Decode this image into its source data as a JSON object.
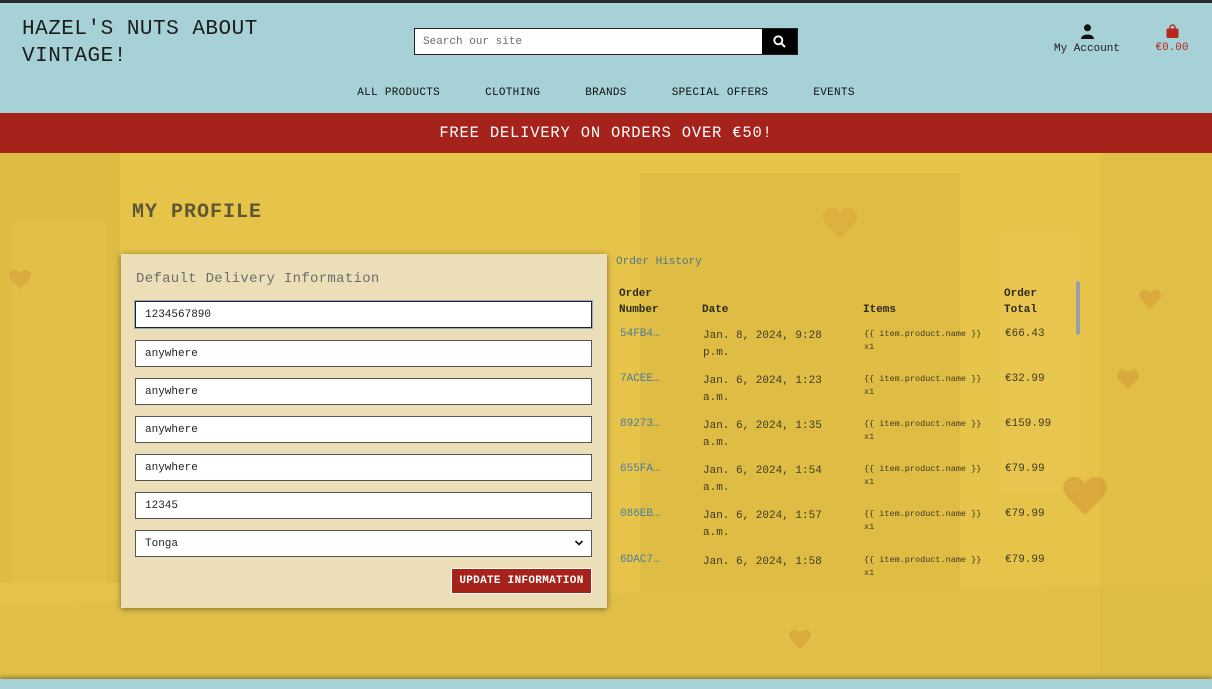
{
  "header": {
    "logo_line1": "HAZEL'S NUTS ABOUT",
    "logo_line2": "VINTAGE!",
    "search_placeholder": "Search our site",
    "account_label": "My Account",
    "bag_total": "€0.00"
  },
  "nav": [
    "ALL PRODUCTS",
    "CLOTHING",
    "BRANDS",
    "SPECIAL OFFERS",
    "EVENTS"
  ],
  "banner": "FREE DELIVERY ON ORDERS OVER €50!",
  "profile": {
    "title": "MY PROFILE",
    "form_title": "Default Delivery Information",
    "fields": [
      "1234567890",
      "anywhere",
      "anywhere",
      "anywhere",
      "anywhere",
      "12345"
    ],
    "country": "Tonga",
    "update_label": "UPDATE INFORMATION"
  },
  "orders": {
    "title": "Order History",
    "headers": {
      "number_1": "Order",
      "number_2": "Number",
      "date": "Date",
      "items": "Items",
      "total_1": "Order",
      "total_2": "Total"
    },
    "rows": [
      {
        "number": "54FB4…",
        "date_1": "Jan. 8, 2024, 9:28",
        "date_2": "p.m.",
        "item_1": "{{ item.product.name }}",
        "item_2": "x1",
        "total": "€66.43"
      },
      {
        "number": "7ACEE…",
        "date_1": "Jan. 6, 2024, 1:23",
        "date_2": "a.m.",
        "item_1": "{{ item.product.name }}",
        "item_2": "x1",
        "total": "€32.99"
      },
      {
        "number": "89273…",
        "date_1": "Jan. 6, 2024, 1:35",
        "date_2": "a.m.",
        "item_1": "{{ item.product.name }}",
        "item_2": "x1",
        "total": "€159.99"
      },
      {
        "number": "655FA…",
        "date_1": "Jan. 6, 2024, 1:54",
        "date_2": "a.m.",
        "item_1": "{{ item.product.name }}",
        "item_2": "x1",
        "total": "€79.99"
      },
      {
        "number": "086EB…",
        "date_1": "Jan. 6, 2024, 1:57",
        "date_2": "a.m.",
        "item_1": "{{ item.product.name }}",
        "item_2": "x1",
        "total": "€79.99"
      },
      {
        "number": "6DAC7…",
        "date_1": "Jan. 6, 2024, 1:58",
        "date_2": "",
        "item_1": "{{ item.product.name }}",
        "item_2": "x1",
        "total": "€79.99"
      }
    ]
  },
  "colors": {
    "header_bg": "#a6d1d6",
    "banner_bg": "#a6231c",
    "main_bg": "#e6c44a",
    "card_bg": "#ecdfb8",
    "link": "#4d7aa0"
  }
}
